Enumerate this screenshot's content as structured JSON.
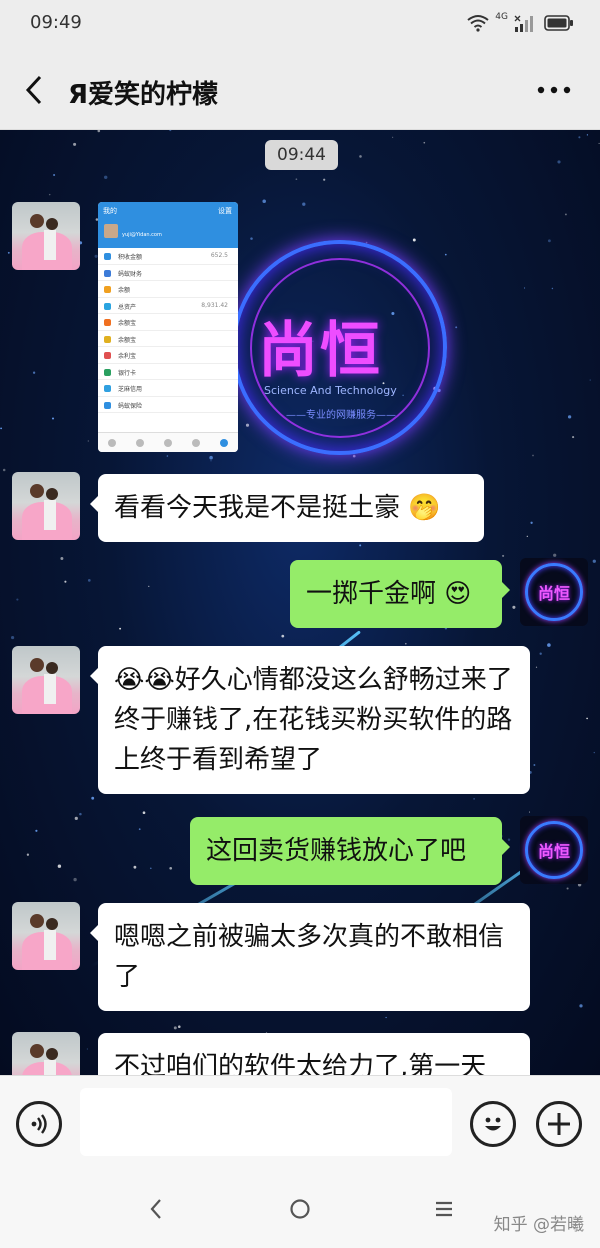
{
  "status_bar": {
    "time": "09:49",
    "network": "4G"
  },
  "header": {
    "title": "Я爱笑的柠檬"
  },
  "chat": {
    "timestamp": "09:44",
    "image_message": {
      "header_label": "我的",
      "header_right": "设置",
      "user_name": "yuji@Yidan.com",
      "rows": [
        {
          "label": "积收金额",
          "value": "652.5 ",
          "color": "#2f8fe0"
        },
        {
          "label": "蚂蚁财务",
          "value": "",
          "color": "#3c7bd8"
        },
        {
          "label": "余额",
          "value": "",
          "color": "#f0a020"
        },
        {
          "label": "总资产",
          "value": "8,931.42",
          "color": "#2aa4e0"
        },
        {
          "label": "余额宝",
          "value": "",
          "color": "#f07020"
        },
        {
          "label": "余额宝",
          "value": "",
          "color": "#e0b020"
        },
        {
          "label": "余利宝",
          "value": "",
          "color": "#e05050"
        },
        {
          "label": "银行卡",
          "value": "",
          "color": "#2aa060"
        },
        {
          "label": "芝麻信用",
          "value": "",
          "color": "#30a0e0"
        },
        {
          "label": "蚂蚁保险",
          "value": "",
          "color": "#2f8fe0"
        }
      ]
    },
    "background_logo": {
      "title": "尚恒",
      "subtitle": "Science And Technology",
      "tagline": "——专业的网赚服务——"
    },
    "messages": [
      {
        "side": "left",
        "text": "看看今天我是不是挺土豪 🤭"
      },
      {
        "side": "right",
        "text": "一掷千金啊 😍"
      },
      {
        "side": "left",
        "text": "😭😭好久心情都没这么舒畅过来了终于赚钱了,在花钱买粉买软件的路上终于看到希望了"
      },
      {
        "side": "right",
        "text": "这回卖货赚钱放心了吧"
      },
      {
        "side": "left",
        "text": "嗯嗯之前被骗太多次真的不敢相信了"
      },
      {
        "side": "left",
        "text": "不过咱们的软件太给力了,第一天"
      }
    ],
    "self_avatar_text": "尚恒"
  },
  "input": {
    "placeholder": ""
  },
  "watermark": "知乎 @若曦",
  "colors": {
    "self_bubble": "#95ec69",
    "other_bubble": "#ffffff",
    "chat_bg": "#071636"
  }
}
